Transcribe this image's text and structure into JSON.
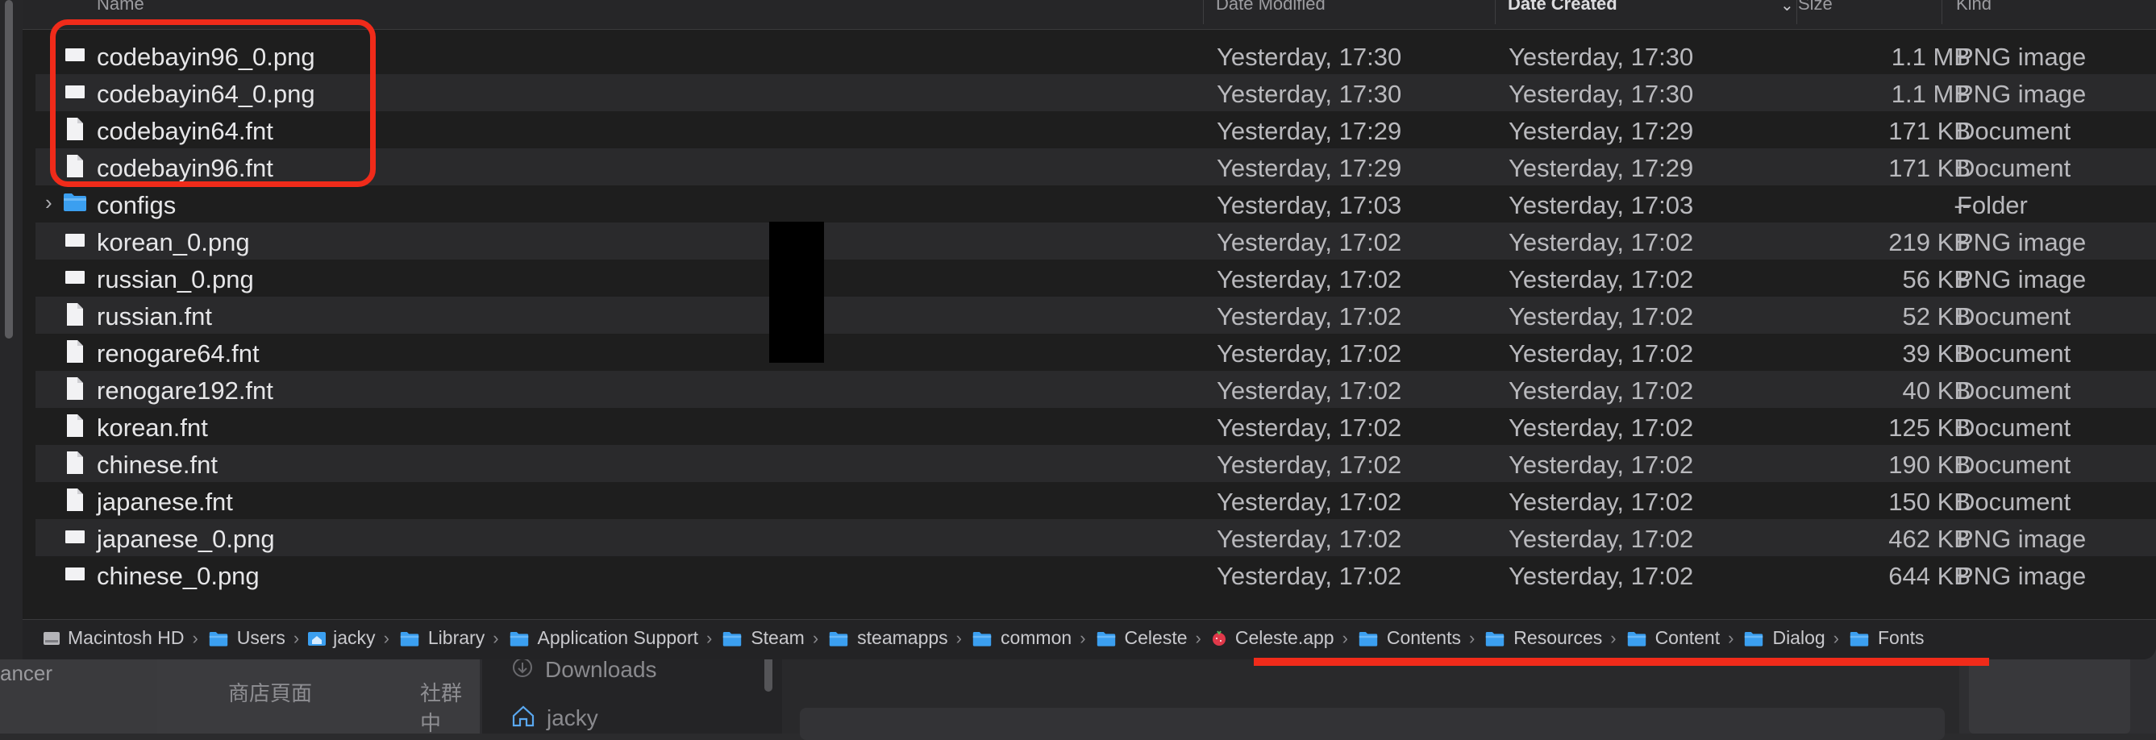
{
  "header": {
    "name": "Name",
    "date_modified": "Date Modified",
    "date_created": "Date Created",
    "size": "Size",
    "kind": "Kind"
  },
  "rows": [
    {
      "name": "codebayin96_0.png",
      "modified": "Yesterday, 17:30",
      "created": "Yesterday, 17:30",
      "size": "1.1 MB",
      "kind": "PNG image",
      "icon": "png-file-icon"
    },
    {
      "name": "codebayin64_0.png",
      "modified": "Yesterday, 17:30",
      "created": "Yesterday, 17:30",
      "size": "1.1 MB",
      "kind": "PNG image",
      "icon": "png-file-icon"
    },
    {
      "name": "codebayin64.fnt",
      "modified": "Yesterday, 17:29",
      "created": "Yesterday, 17:29",
      "size": "171 KB",
      "kind": "Document",
      "icon": "document-icon"
    },
    {
      "name": "codebayin96.fnt",
      "modified": "Yesterday, 17:29",
      "created": "Yesterday, 17:29",
      "size": "171 KB",
      "kind": "Document",
      "icon": "document-icon"
    },
    {
      "name": "configs",
      "modified": "Yesterday, 17:03",
      "created": "Yesterday, 17:03",
      "size": "--",
      "kind": "Folder",
      "icon": "folder-icon"
    },
    {
      "name": "korean_0.png",
      "modified": "Yesterday, 17:02",
      "created": "Yesterday, 17:02",
      "size": "219 KB",
      "kind": "PNG image",
      "icon": "png-file-icon"
    },
    {
      "name": "russian_0.png",
      "modified": "Yesterday, 17:02",
      "created": "Yesterday, 17:02",
      "size": "56 KB",
      "kind": "PNG image",
      "icon": "png-file-icon"
    },
    {
      "name": "russian.fnt",
      "modified": "Yesterday, 17:02",
      "created": "Yesterday, 17:02",
      "size": "52 KB",
      "kind": "Document",
      "icon": "document-icon"
    },
    {
      "name": "renogare64.fnt",
      "modified": "Yesterday, 17:02",
      "created": "Yesterday, 17:02",
      "size": "39 KB",
      "kind": "Document",
      "icon": "document-icon"
    },
    {
      "name": "renogare192.fnt",
      "modified": "Yesterday, 17:02",
      "created": "Yesterday, 17:02",
      "size": "40 KB",
      "kind": "Document",
      "icon": "document-icon"
    },
    {
      "name": "korean.fnt",
      "modified": "Yesterday, 17:02",
      "created": "Yesterday, 17:02",
      "size": "125 KB",
      "kind": "Document",
      "icon": "document-icon"
    },
    {
      "name": "chinese.fnt",
      "modified": "Yesterday, 17:02",
      "created": "Yesterday, 17:02",
      "size": "190 KB",
      "kind": "Document",
      "icon": "document-icon"
    },
    {
      "name": "japanese.fnt",
      "modified": "Yesterday, 17:02",
      "created": "Yesterday, 17:02",
      "size": "150 KB",
      "kind": "Document",
      "icon": "document-icon"
    },
    {
      "name": "japanese_0.png",
      "modified": "Yesterday, 17:02",
      "created": "Yesterday, 17:02",
      "size": "462 KB",
      "kind": "PNG image",
      "icon": "png-file-icon"
    },
    {
      "name": "chinese_0.png",
      "modified": "Yesterday, 17:02",
      "created": "Yesterday, 17:02",
      "size": "644 KB",
      "kind": "PNG image",
      "icon": "png-file-icon"
    }
  ],
  "path": [
    {
      "label": "Macintosh HD",
      "icon": "hard-drive-icon"
    },
    {
      "label": "Users",
      "icon": "folder-icon"
    },
    {
      "label": "jacky",
      "icon": "home-icon"
    },
    {
      "label": "Library",
      "icon": "folder-icon"
    },
    {
      "label": "Application Support",
      "icon": "folder-icon"
    },
    {
      "label": "Steam",
      "icon": "folder-icon"
    },
    {
      "label": "steamapps",
      "icon": "folder-icon"
    },
    {
      "label": "common",
      "icon": "folder-icon"
    },
    {
      "label": "Celeste",
      "icon": "folder-icon"
    },
    {
      "label": "Celeste.app",
      "icon": "app-icon"
    },
    {
      "label": "Contents",
      "icon": "folder-icon"
    },
    {
      "label": "Resources",
      "icon": "folder-icon"
    },
    {
      "label": "Content",
      "icon": "folder-icon"
    },
    {
      "label": "Dialog",
      "icon": "folder-icon"
    },
    {
      "label": "Fonts",
      "icon": "folder-icon"
    }
  ],
  "background": {
    "left_text": "ancer",
    "tab1": "商店頁面",
    "tab2": "社群中",
    "sidebar1": "Downloads",
    "sidebar2": "jacky"
  },
  "colors": {
    "annotation": "#f02b1a",
    "folder": "#3b9ff0"
  }
}
